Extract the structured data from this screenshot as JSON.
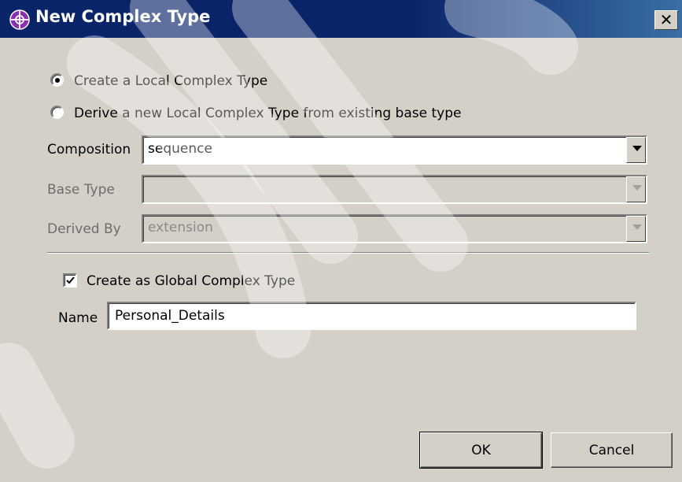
{
  "window": {
    "title": "New Complex Type",
    "close_glyph": "✕",
    "icon": "complex-type-icon"
  },
  "options": {
    "create_local": {
      "label": "Create a Local Complex Type",
      "selected": true
    },
    "derive_local": {
      "label": "Derive a new Local Complex Type from existing base type",
      "selected": false
    }
  },
  "composition": {
    "label": "Composition",
    "value": "sequence"
  },
  "base_type": {
    "label": "Base Type",
    "value": ""
  },
  "derived_by": {
    "label": "Derived By",
    "value": "extension"
  },
  "global": {
    "label": "Create as Global Complex Type",
    "checked": true
  },
  "name": {
    "label": "Name",
    "value": "Personal_Details"
  },
  "buttons": {
    "ok": "OK",
    "cancel": "Cancel"
  },
  "colors": {
    "titlebar": "#0a246a",
    "dialog_bg": "#d4d0c8",
    "disabled_text": "#6d6d6d"
  }
}
